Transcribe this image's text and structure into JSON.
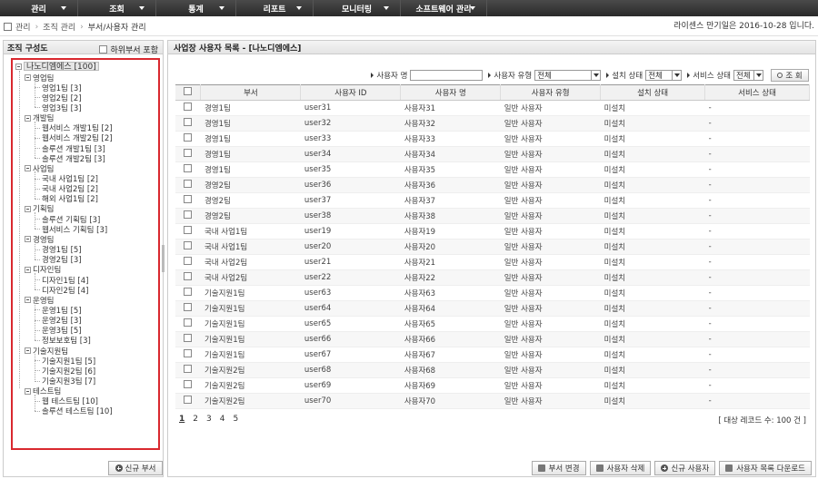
{
  "nav": {
    "items": [
      "관리",
      "조회",
      "통계",
      "리포트",
      "모니터링",
      "소프트웨어 관리"
    ]
  },
  "breadcrumb": [
    "관리",
    "조직 관리",
    "부서/사용자 관리"
  ],
  "license_notice": "라이센스 만기일은 2016-10-28 입니다.",
  "left_panel": {
    "title": "조직 구성도",
    "include_sub_label": "하위부서 포함",
    "new_dept_label": "신규 부서",
    "root": "나노디엠에스 [100]",
    "groups": [
      {
        "name": "영업팀",
        "children": [
          "영업1팀 [3]",
          "영업2팀 [2]",
          "영업3팀 [3]"
        ]
      },
      {
        "name": "개발팀",
        "children": [
          "웹서비스 개발1팀 [2]",
          "웹서비스 개발2팀 [2]",
          "솔루션 개발1팀 [3]",
          "솔루션 개발2팀 [3]"
        ]
      },
      {
        "name": "사업팀",
        "children": [
          "국내 사업1팀 [2]",
          "국내 사업2팀 [2]",
          "해외 사업1팀 [2]"
        ]
      },
      {
        "name": "기획팀",
        "children": [
          "솔루션 기획팀 [3]",
          "웹서비스 기획팀 [3]"
        ]
      },
      {
        "name": "경영팀",
        "children": [
          "경영1팀 [5]",
          "경영2팀 [3]"
        ]
      },
      {
        "name": "디자인팀",
        "children": [
          "디자인1팀 [4]",
          "디자인2팀 [4]"
        ]
      },
      {
        "name": "운영팀",
        "children": [
          "운영1팀 [5]",
          "운영2팀 [3]",
          "운영3팀 [5]",
          "정보보호팀 [3]"
        ]
      },
      {
        "name": "기술지원팀",
        "children": [
          "기술지원1팀 [5]",
          "기술지원2팀 [6]",
          "기술지원3팀 [7]"
        ]
      },
      {
        "name": "테스트팀",
        "children": [
          "웹 테스트팀 [10]",
          "솔루션 테스트팀 [10]"
        ]
      }
    ]
  },
  "main_panel": {
    "title": "사업장 사용자 목록 - [나노디엠에스]",
    "filters": {
      "user_name_label": "사용자 명",
      "user_type_label": "사용자 유형",
      "user_type_value": "전체",
      "install_label": "설치 상태",
      "install_value": "전체",
      "service_label": "서비스 상태",
      "service_value": "전체",
      "search_label": "조 회"
    },
    "columns": [
      "부서",
      "사용자 ID",
      "사용자 명",
      "사용자 유형",
      "설치 상태",
      "서비스 상태"
    ],
    "rows": [
      [
        "경영1팀",
        "user31",
        "사용자31",
        "일반 사용자",
        "미설치",
        "-"
      ],
      [
        "경영1팀",
        "user32",
        "사용자32",
        "일반 사용자",
        "미설치",
        "-"
      ],
      [
        "경영1팀",
        "user33",
        "사용자33",
        "일반 사용자",
        "미설치",
        "-"
      ],
      [
        "경영1팀",
        "user34",
        "사용자34",
        "일반 사용자",
        "미설치",
        "-"
      ],
      [
        "경영1팀",
        "user35",
        "사용자35",
        "일반 사용자",
        "미설치",
        "-"
      ],
      [
        "경영2팀",
        "user36",
        "사용자36",
        "일반 사용자",
        "미설치",
        "-"
      ],
      [
        "경영2팀",
        "user37",
        "사용자37",
        "일반 사용자",
        "미설치",
        "-"
      ],
      [
        "경영2팀",
        "user38",
        "사용자38",
        "일반 사용자",
        "미설치",
        "-"
      ],
      [
        "국내 사업1팀",
        "user19",
        "사용자19",
        "일반 사용자",
        "미설치",
        "-"
      ],
      [
        "국내 사업1팀",
        "user20",
        "사용자20",
        "일반 사용자",
        "미설치",
        "-"
      ],
      [
        "국내 사업2팀",
        "user21",
        "사용자21",
        "일반 사용자",
        "미설치",
        "-"
      ],
      [
        "국내 사업2팀",
        "user22",
        "사용자22",
        "일반 사용자",
        "미설치",
        "-"
      ],
      [
        "기술지원1팀",
        "user63",
        "사용자63",
        "일반 사용자",
        "미설치",
        "-"
      ],
      [
        "기술지원1팀",
        "user64",
        "사용자64",
        "일반 사용자",
        "미설치",
        "-"
      ],
      [
        "기술지원1팀",
        "user65",
        "사용자65",
        "일반 사용자",
        "미설치",
        "-"
      ],
      [
        "기술지원1팀",
        "user66",
        "사용자66",
        "일반 사용자",
        "미설치",
        "-"
      ],
      [
        "기술지원1팀",
        "user67",
        "사용자67",
        "일반 사용자",
        "미설치",
        "-"
      ],
      [
        "기술지원2팀",
        "user68",
        "사용자68",
        "일반 사용자",
        "미설치",
        "-"
      ],
      [
        "기술지원2팀",
        "user69",
        "사용자69",
        "일반 사용자",
        "미설치",
        "-"
      ],
      [
        "기술지원2팀",
        "user70",
        "사용자70",
        "일반 사용자",
        "미설치",
        "-"
      ]
    ],
    "pages": [
      "1",
      "2",
      "3",
      "4",
      "5"
    ],
    "current_page": "1",
    "record_count": "[ 대상 레코드 수: 100 건 ]",
    "actions": [
      "부서 변경",
      "사용자 삭제",
      "신규 사용자",
      "사용자 목록 다운로드"
    ]
  }
}
